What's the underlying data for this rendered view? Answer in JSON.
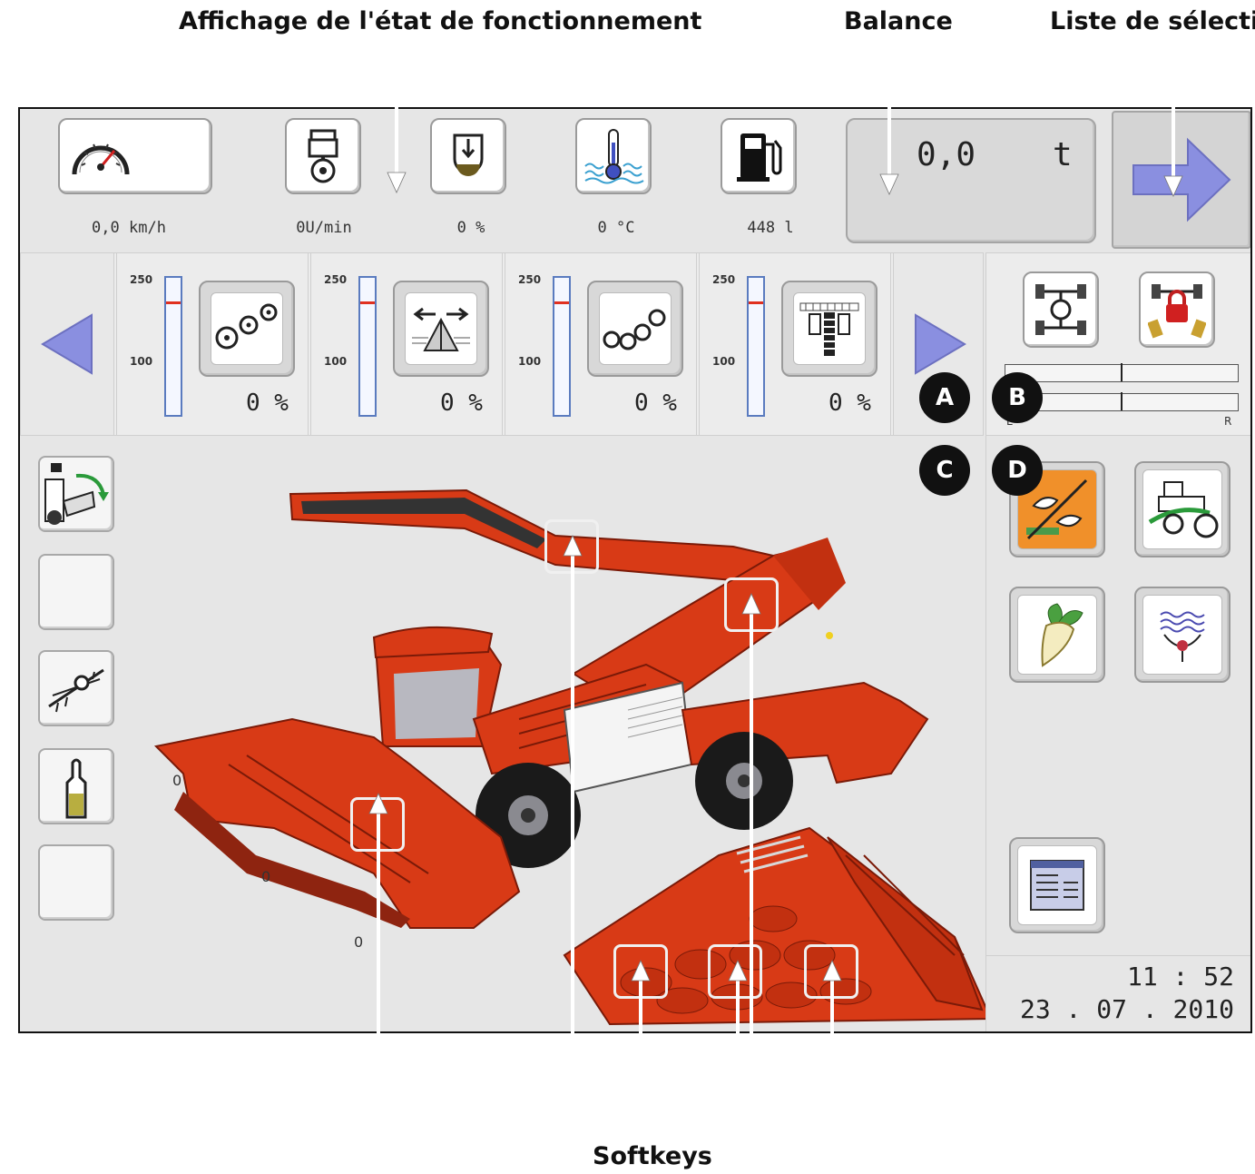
{
  "callouts": {
    "status_display": "Affichage de l'état de fonctionnement",
    "balance": "Balance",
    "selection_list": "Liste de sélection",
    "softkeys": "Softkeys"
  },
  "status_bar": {
    "speed": "0,0 km/h",
    "engine_rpm": "0U/min",
    "tank_level": "0 %",
    "coolant_temp": "0 °C",
    "fuel": "448 l",
    "scale_value": "0,0",
    "scale_unit": "t"
  },
  "gauges": {
    "scale_max": "250",
    "scale_mid": "100",
    "items": [
      {
        "icon": "defoliator-rollers-icon",
        "percent": "0 %"
      },
      {
        "icon": "lifting-share-spread-icon",
        "percent": "0 %"
      },
      {
        "icon": "cleaning-rollers-icon",
        "percent": "0 %"
      },
      {
        "icon": "conveyor-belt-icon",
        "percent": "0 %"
      }
    ]
  },
  "steering_panel": {
    "scale_right_label": "R",
    "scale_left_label": "L"
  },
  "badges": {
    "a": "A",
    "b": "B",
    "c": "C",
    "d": "D"
  },
  "machine_labels": {
    "p1": "0",
    "p2": "0",
    "p3": "0"
  },
  "clock": {
    "time": "11 : 52",
    "date": "23 . 07 . 2010"
  },
  "colors": {
    "screen_bg": "#e6e6e6",
    "machine_red": "#d83a16",
    "arrow_blue": "#8a8fe0",
    "badge_black": "#111111",
    "active_orange": "#f0902a"
  }
}
